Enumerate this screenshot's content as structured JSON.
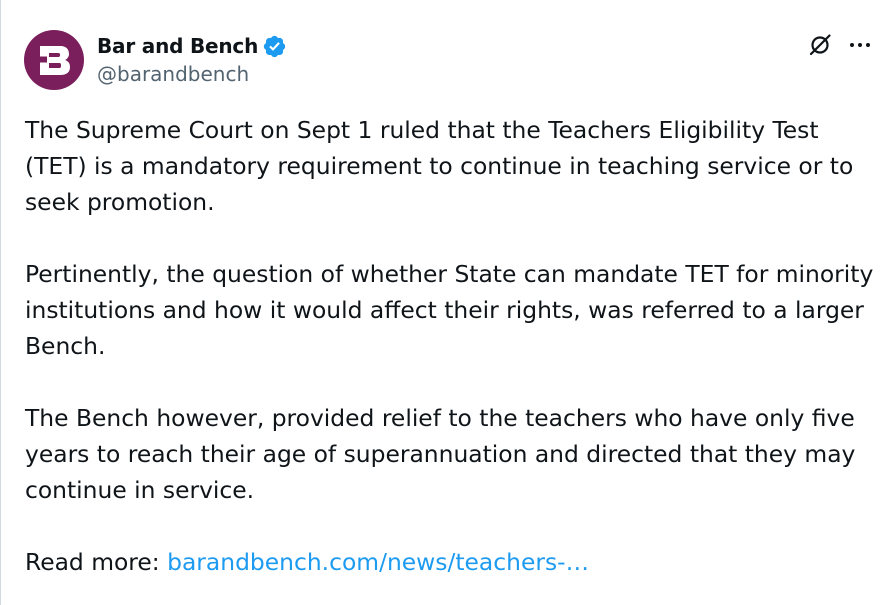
{
  "author": {
    "display_name": "Bar and Bench",
    "handle": "@barandbench",
    "verified": true,
    "avatar_letter": "B",
    "avatar_color": "#7a1f5c"
  },
  "icons": {
    "grok": "grok-icon",
    "more": "more-icon",
    "verified": "verified-badge-icon"
  },
  "colors": {
    "text": "#0f1419",
    "secondary": "#536471",
    "link": "#1d9bf0",
    "verified": "#1d9bf0"
  },
  "tweet": {
    "paragraph_1": "The Supreme Court on Sept 1 ruled that the Teachers Eligibility Test (TET) is a mandatory requirement to continue in teaching service or to seek promotion.",
    "paragraph_2": "Pertinently, the question of whether State can mandate TET for minority institutions and how it would affect their rights, was referred to a larger Bench.",
    "paragraph_3": "The Bench however, provided relief to the teachers who have only five years to reach their age of superannuation and directed that they may continue in service.",
    "read_more_prefix": "Read more: ",
    "link_text": "barandbench.com/news/teachers-…"
  }
}
